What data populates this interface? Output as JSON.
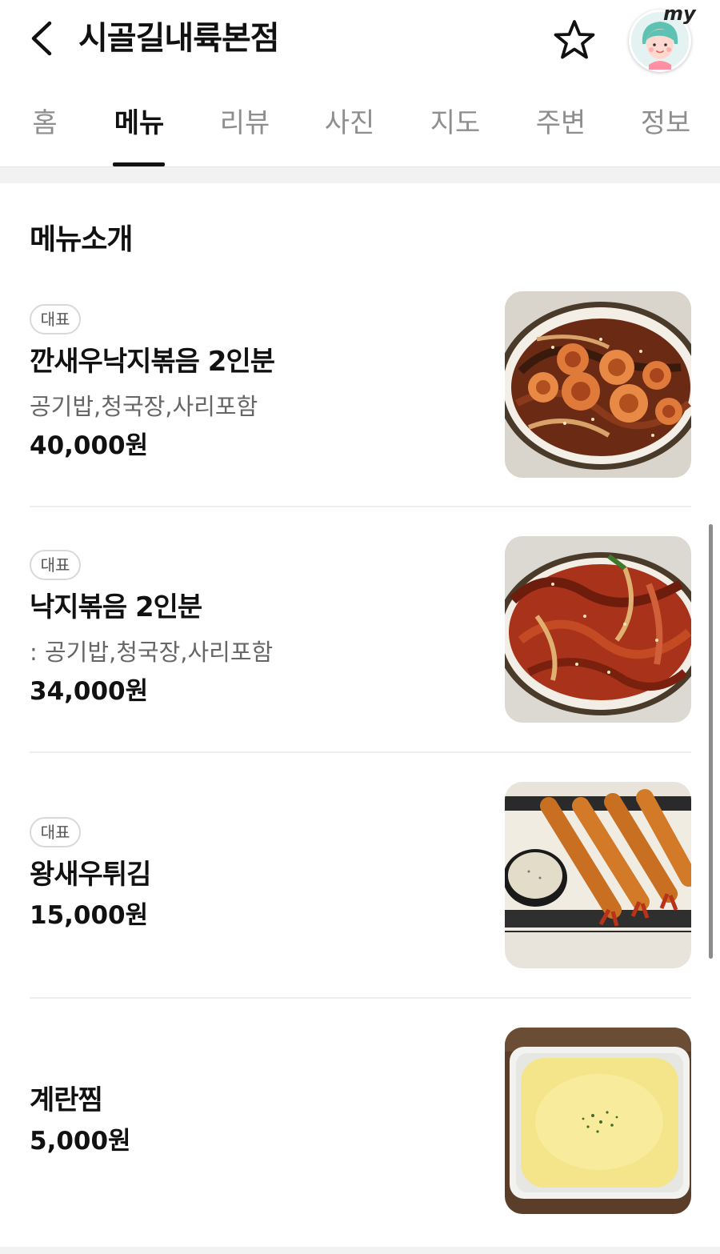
{
  "header": {
    "title": "시골길내륙본점",
    "back_icon": "chevron-left-icon",
    "favorite_icon": "star-outline-icon",
    "my_label": "my"
  },
  "tabs": [
    {
      "label": "홈",
      "active": false
    },
    {
      "label": "메뉴",
      "active": true
    },
    {
      "label": "리뷰",
      "active": false
    },
    {
      "label": "사진",
      "active": false
    },
    {
      "label": "지도",
      "active": false
    },
    {
      "label": "주변",
      "active": false
    },
    {
      "label": "정보",
      "active": false
    }
  ],
  "section": {
    "title": "메뉴소개"
  },
  "menu": [
    {
      "badge": "대표",
      "name": "깐새우낙지볶음 2인분",
      "description": "공기밥,청국장,사리포함",
      "price": "40,000원",
      "photo": "shrimp-octopus-stirfry-photo"
    },
    {
      "badge": "대표",
      "name": "낙지볶음 2인분",
      "description": ": 공기밥,청국장,사리포함",
      "price": "34,000원",
      "photo": "octopus-stirfry-photo"
    },
    {
      "badge": "대표",
      "name": "왕새우튀김",
      "description": "",
      "price": "15,000원",
      "photo": "fried-prawn-photo"
    },
    {
      "badge": "",
      "name": "계란찜",
      "description": "",
      "price": "5,000원",
      "photo": "steamed-egg-photo"
    }
  ],
  "colors": {
    "text_primary": "#111111",
    "text_secondary": "#666666",
    "tab_inactive": "#8e8e8e",
    "divider": "#eeeeee",
    "section_gap": "#f2f2f2"
  }
}
